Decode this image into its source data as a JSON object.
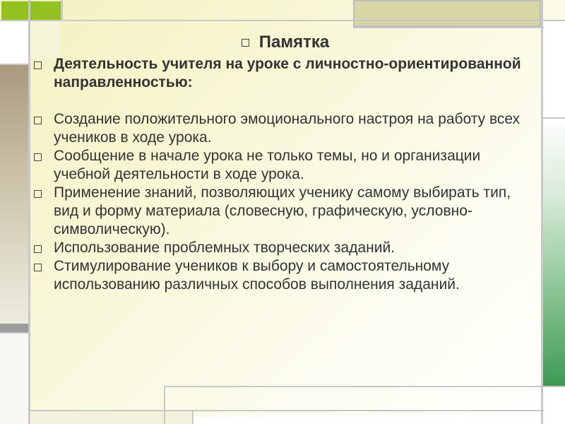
{
  "slide": {
    "title": "Памятка",
    "heading": "Деятельность учителя на уроке с личностно-ориентированной направленностью:",
    "items": [
      "Создание положительного эмоционального настроя на работу всех учеников в ходе урока.",
      "Сообщение в начале урока не только темы, но и организации учебной деятельности в ходе урока.",
      "Применение знаний, позволяющих ученику самому выбирать тип, вид и форму материала (словесную, графическую, условно-символическую).",
      "Использование проблемных творческих заданий.",
      "Стимулирование учеников к выбору и самостоятельному использованию различных способов выполнения заданий."
    ]
  },
  "icons": {
    "bullet": "square-outline-bullet-icon"
  },
  "colors": {
    "text": "#333333",
    "accent_green": "#94c020",
    "accent_tan": "#d8d5a6",
    "side_brown": "#a99a80",
    "side_green": "#3f9a55",
    "background": "#f8f7d6"
  }
}
